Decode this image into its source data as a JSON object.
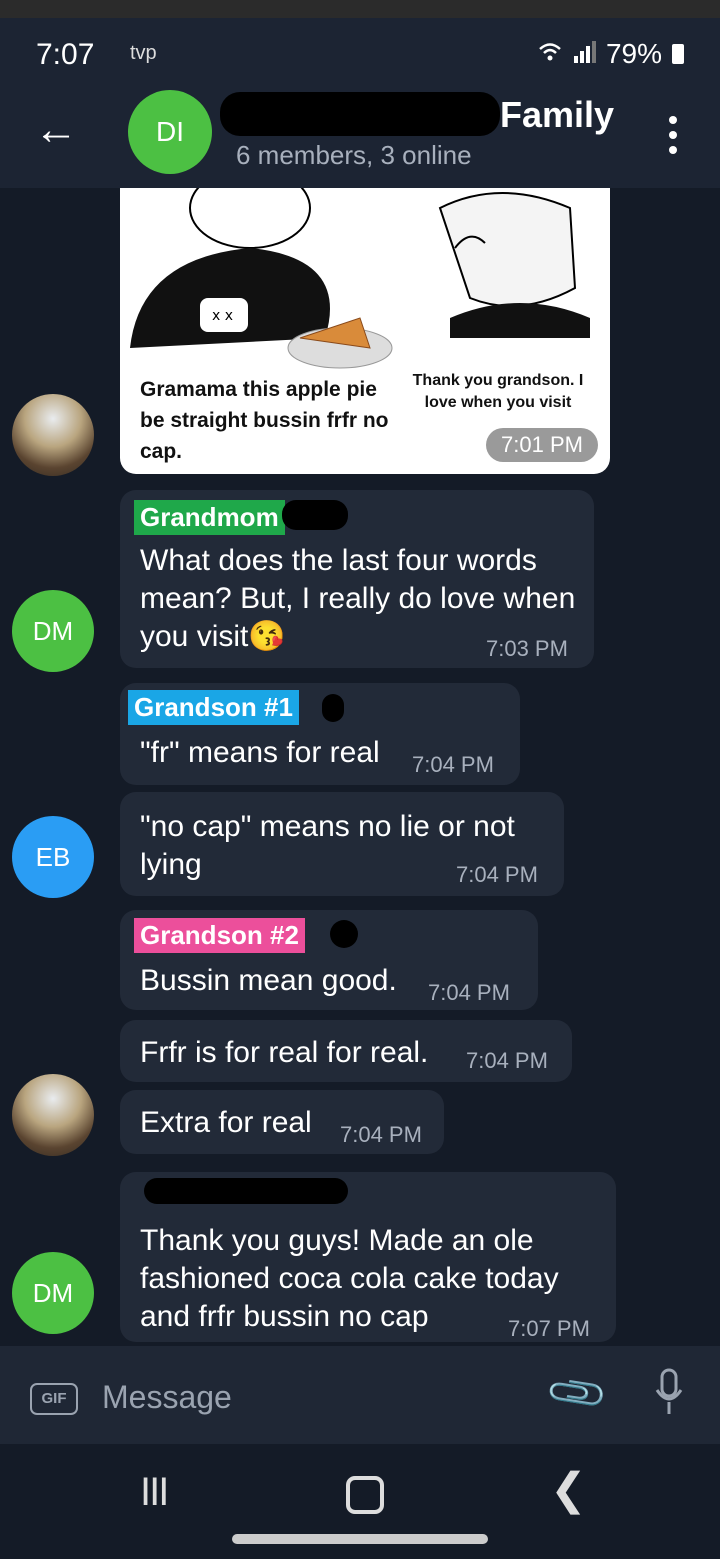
{
  "status_bar": {
    "time": "7:07",
    "app_text": "tvp",
    "battery": "79%"
  },
  "header": {
    "avatar_initials": "DI",
    "title": "Family",
    "subtitle": "6 members, 3 online"
  },
  "meme": {
    "caption_left": "Gramama this apple pie be straight bussin frfr no cap.",
    "caption_right": "Thank you grandson. I love when you visit",
    "time": "7:01 PM"
  },
  "messages": [
    {
      "sender_tag": "Grandmom",
      "avatar": "DM",
      "text": "What does the last four words mean? But, I really do love when you visit😘",
      "time": "7:03 PM"
    },
    {
      "sender_tag": "Grandson #1",
      "text": "\"fr\" means for real",
      "time": "7:04 PM"
    },
    {
      "avatar": "EB",
      "text": "\"no cap\" means no lie or not lying",
      "time": "7:04 PM"
    },
    {
      "sender_tag": "Grandson #2",
      "text": "Bussin mean good.",
      "time": "7:04 PM"
    },
    {
      "text": "Frfr is for real for real.",
      "time": "7:04 PM"
    },
    {
      "text": "Extra for real",
      "time": "7:04 PM"
    },
    {
      "avatar": "DM",
      "text": "Thank you guys!  Made an ole fashioned coca cola cake today and frfr bussin no cap",
      "time": "7:07 PM"
    }
  ],
  "input_bar": {
    "gif_label": "GIF",
    "placeholder": "Message"
  },
  "icons": [
    "back-arrow-icon",
    "more-vert-icon",
    "gif-icon",
    "attach-icon",
    "mic-icon",
    "recent-apps-icon",
    "home-icon",
    "nav-back-icon"
  ]
}
